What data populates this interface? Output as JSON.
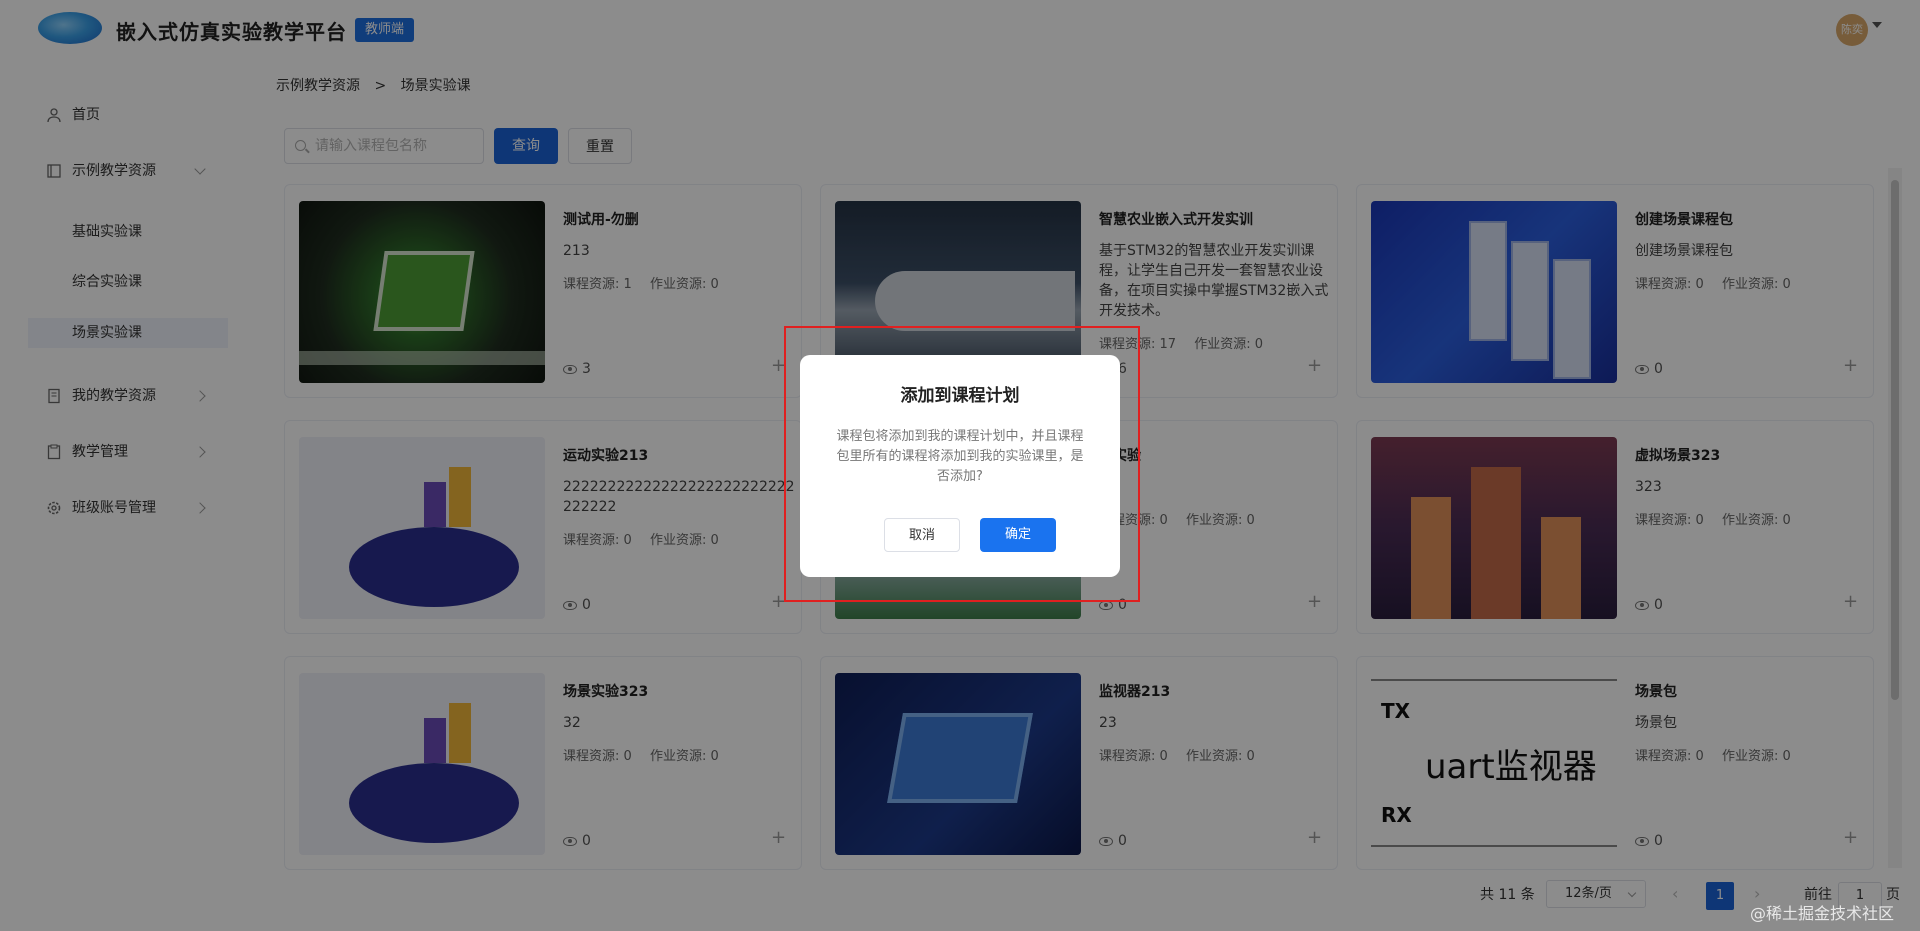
{
  "header": {
    "app_title": "嵌入式仿真实验教学平台",
    "role_badge": "教师端",
    "avatar_text": "陈奕"
  },
  "sidebar": {
    "items": [
      {
        "label": "首页",
        "icon": "user-icon"
      },
      {
        "label": "示例教学资源",
        "icon": "book-icon",
        "expanded": true
      },
      {
        "label": "我的教学资源",
        "icon": "document-icon"
      },
      {
        "label": "教学管理",
        "icon": "clipboard-icon"
      },
      {
        "label": "班级账号管理",
        "icon": "gear-icon"
      }
    ],
    "sub_items": [
      "基础实验课",
      "综合实验课",
      "场景实验课"
    ],
    "active_sub_item": "场景实验课"
  },
  "breadcrumb": {
    "parent": "示例教学资源",
    "separator": ">",
    "current": "场景实验课"
  },
  "search": {
    "placeholder": "请输入课程包名称",
    "value": "",
    "query_label": "查询",
    "reset_label": "重置"
  },
  "cards": [
    {
      "title": "测试用-勿删",
      "desc": "213",
      "course_res": "课程资源: 1",
      "work_res": "作业资源: 0",
      "views": "3",
      "art": "pcb"
    },
    {
      "title": "智慧农业嵌入式开发实训",
      "desc": "基于STM32的智慧农业开发实训课程，让学生自己开发一套智慧农业设备，在项目实操中掌握STM32嵌入式开发技术。",
      "course_res": "课程资源: 17",
      "work_res": "作业资源: 0",
      "views": "6",
      "art": "train"
    },
    {
      "title": "创建场景课程包",
      "desc": "创建场景课程包",
      "course_res": "课程资源: 0",
      "work_res": "作业资源: 0",
      "views": "0",
      "art": "server"
    },
    {
      "title": "运动实验213",
      "desc": "22222222222222222222222222222222",
      "course_res": "课程资源: 0",
      "work_res": "作业资源: 0",
      "views": "0",
      "art": "people"
    },
    {
      "title": "场实验",
      "desc": "",
      "course_res": "课程资源: 0",
      "work_res": "作业资源: 0",
      "views": "0",
      "art": "mixed"
    },
    {
      "title": "虚拟场景323",
      "desc": "323",
      "course_res": "课程资源: 0",
      "work_res": "作业资源: 0",
      "views": "0",
      "art": "city"
    },
    {
      "title": "场景实验323",
      "desc": "32",
      "course_res": "课程资源: 0",
      "work_res": "作业资源: 0",
      "views": "0",
      "art": "people"
    },
    {
      "title": "监视器213",
      "desc": "23",
      "course_res": "课程资源: 0",
      "work_res": "作业资源: 0",
      "views": "0",
      "art": "monitor"
    },
    {
      "title": "场景包",
      "desc": "场景包",
      "course_res": "课程资源: 0",
      "work_res": "作业资源: 0",
      "views": "0",
      "art": "uart"
    }
  ],
  "uart_art": {
    "tx": "TX",
    "rx": "RX",
    "big": "uart监视器"
  },
  "pagination": {
    "total": "共 11 条",
    "page_size": "12条/页",
    "current_page": "1",
    "goto_label": "前往",
    "goto_value": "1",
    "page_unit": "页"
  },
  "dialog": {
    "title": "添加到课程计划",
    "message": "课程包将添加到我的课程计划中，并且课程包里所有的课程将添加到我的实验课里，是否添加?",
    "cancel_label": "取消",
    "confirm_label": "确定"
  },
  "watermark": "@稀土掘金技术社区",
  "colors": {
    "primary": "#1a63d8",
    "dialog_confirm": "#1a73ef",
    "highlight": "#e02020"
  }
}
